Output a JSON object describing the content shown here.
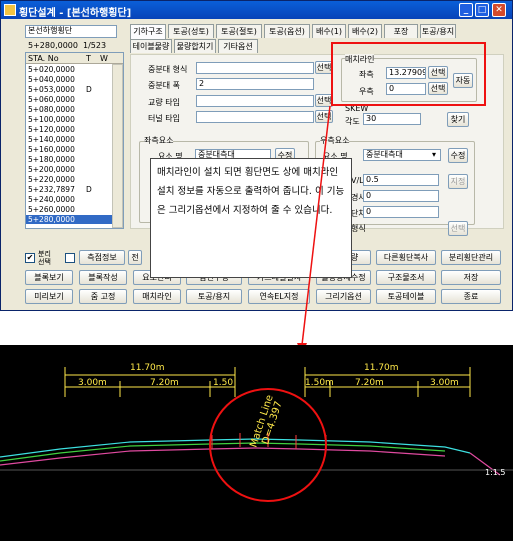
{
  "window": {
    "title": "횡단설계 - [본선하행횡단]"
  },
  "controls": {
    "min": "_",
    "max": "□",
    "close": "✕"
  },
  "left_panel": {
    "combo": "본선하행횡단",
    "station": "5+280,0000",
    "page": "1/523",
    "col_sta": "STA. No",
    "col_t": "T",
    "col_w": "W",
    "rows": [
      [
        "5+020,0000",
        ""
      ],
      [
        "5+040,0000",
        ""
      ],
      [
        "5+053,0000",
        "D"
      ],
      [
        "5+060,0000",
        ""
      ],
      [
        "5+080,0000",
        ""
      ],
      [
        "5+100,0000",
        ""
      ],
      [
        "5+120,0000",
        ""
      ],
      [
        "5+140,0000",
        ""
      ],
      [
        "5+160,0000",
        ""
      ],
      [
        "5+180,0000",
        ""
      ],
      [
        "5+200,0000",
        ""
      ],
      [
        "5+220,0000",
        ""
      ],
      [
        "5+232,7897",
        "D"
      ],
      [
        "5+240,0000",
        ""
      ],
      [
        "5+260,0000",
        ""
      ],
      [
        "5+280,0000",
        ""
      ]
    ]
  },
  "tabs_row1": [
    "기하구조",
    "토공(성토)",
    "토공(절토)",
    "토공(옵션)",
    "배수(1)",
    "배수(2)",
    "포장",
    "토공/용지"
  ],
  "tabs_row2": [
    "테이블물량",
    "물량합치기",
    "기타옵션"
  ],
  "fields": {
    "f1_label": "중분대 형식",
    "f2_label": "중분대 폭",
    "f2_value": "2",
    "f3_label": "교량 타입",
    "f4_label": "터널 타입",
    "select": "선택"
  },
  "match_line": {
    "title": "매치라인",
    "x_label": "좌측",
    "x_value": "13.27909",
    "r_label": "우측",
    "r_value": "0",
    "select": "선택",
    "auto": "자동"
  },
  "skew": {
    "title": "SKEW",
    "angle_label": "각도",
    "angle_value": "30",
    "find": "찾기"
  },
  "left_elem": {
    "title": "좌측요소",
    "name_label": "요소 명",
    "name_value": "중분대측대",
    "edit": "수정"
  },
  "right_elem": {
    "title": "우측요소",
    "name_label": "요소 명",
    "name_value": "중분대측대",
    "edit": "수정",
    "v_label": "V/L/H",
    "v_value": "0.5",
    "slope_label": "경사",
    "slope_value": "0",
    "step_label": "단차",
    "step_value": "0",
    "type_label": "형식",
    "apply": "지정",
    "select2": "선택"
  },
  "callout": {
    "text": "매치라인이 설치 되면 횡단면도 상에 매치라인 설치 정보를 자동으로 출력하여 줍니다. 이 기능은 그리기옵션에서 지정하여 줄 수 있습니다."
  },
  "bottom": {
    "chk1": "분리",
    "chk1b": "선택",
    "btn_row1": [
      "측점정보",
      "전",
      "배수관",
      "이브물량",
      "다른횡단복사",
      "분리횡단관리"
    ],
    "btn_row2": [
      "블록보기",
      "블록작성",
      "요소관리",
      "암선수정",
      "가드레일설치",
      "물량상세수정",
      "구조물조서",
      "저장"
    ],
    "btn_row3": [
      "미리보기",
      "줌 고정",
      "매치라인",
      "토공/용지",
      "연속EL지정",
      "그리기옵션",
      "토공테이블",
      "종료"
    ]
  },
  "cad": {
    "dim_total": "11.70m",
    "dim_l1": "3.00m",
    "dim_l2": "7.20m",
    "dim_l3": "1.50",
    "dim_r1": "1.50m",
    "dim_r2": "7.20m",
    "dim_r3": "3.00m",
    "match_a": "Match Line",
    "match_b": "D=4.397",
    "side_label": "1:1.5"
  },
  "colors": {
    "highlight": "#e11111",
    "title_bar": "#0a5fd8"
  }
}
